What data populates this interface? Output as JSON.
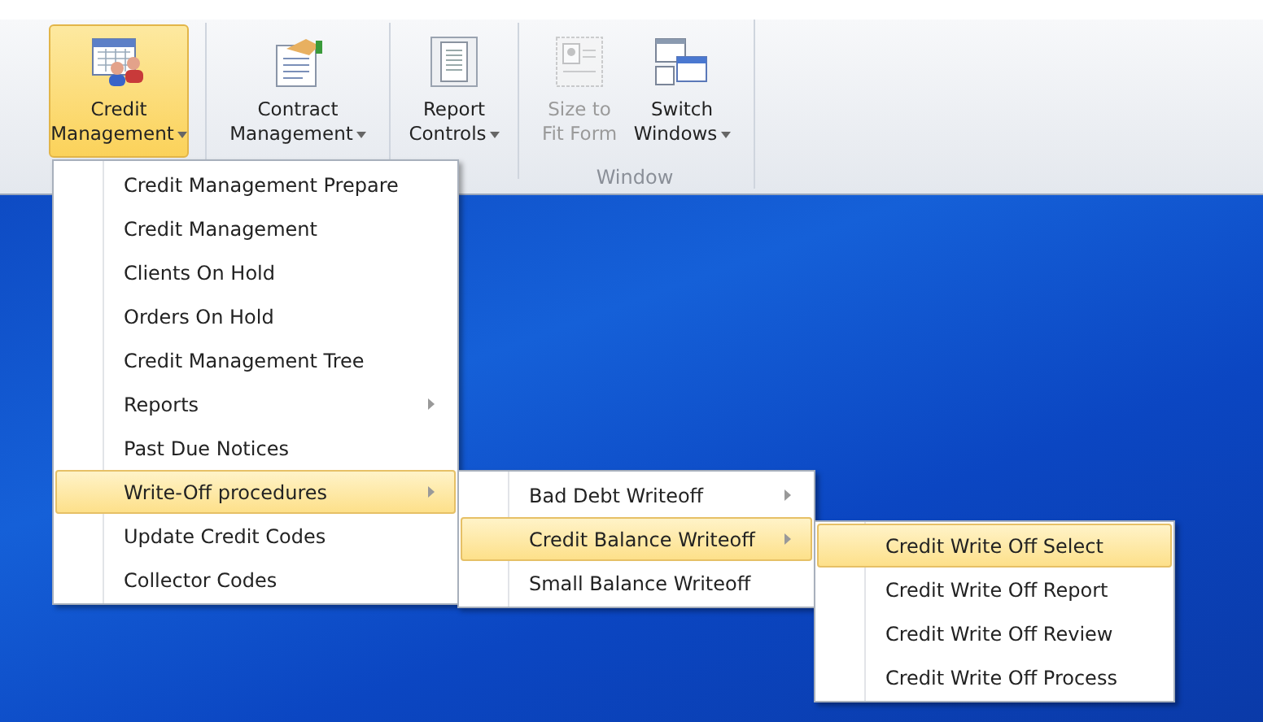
{
  "ribbon": {
    "buttons": [
      {
        "label": "Credit Management",
        "dropdown": true,
        "selected": true,
        "disabled": false
      },
      {
        "label": "Contract Management",
        "dropdown": true,
        "selected": false,
        "disabled": false
      },
      {
        "label": "Report Controls",
        "dropdown": true,
        "selected": false,
        "disabled": false
      },
      {
        "label": "Size to Fit Form",
        "dropdown": false,
        "selected": false,
        "disabled": true
      },
      {
        "label": "Switch Windows",
        "dropdown": true,
        "selected": false,
        "disabled": false
      }
    ],
    "group_label": "Window"
  },
  "menu": {
    "items": [
      {
        "label": "Credit Management Prepare",
        "submenu": false,
        "selected": false
      },
      {
        "label": "Credit Management",
        "submenu": false,
        "selected": false
      },
      {
        "label": "Clients On Hold",
        "submenu": false,
        "selected": false
      },
      {
        "label": "Orders On Hold",
        "submenu": false,
        "selected": false
      },
      {
        "label": "Credit Management Tree",
        "submenu": false,
        "selected": false
      },
      {
        "label": "Reports",
        "submenu": true,
        "selected": false
      },
      {
        "label": "Past Due Notices",
        "submenu": false,
        "selected": false
      },
      {
        "label": "Write-Off procedures",
        "submenu": true,
        "selected": true
      },
      {
        "label": "Update Credit Codes",
        "submenu": false,
        "selected": false
      },
      {
        "label": "Collector Codes",
        "submenu": false,
        "selected": false
      }
    ]
  },
  "submenu": {
    "items": [
      {
        "label": "Bad Debt Writeoff",
        "submenu": true,
        "selected": false
      },
      {
        "label": "Credit Balance Writeoff",
        "submenu": true,
        "selected": true
      },
      {
        "label": "Small Balance Writeoff",
        "submenu": false,
        "selected": false
      }
    ]
  },
  "submenu_2": {
    "items": [
      {
        "label": "Credit Write Off Select",
        "submenu": false,
        "selected": true
      },
      {
        "label": "Credit Write Off Report",
        "submenu": false,
        "selected": false
      },
      {
        "label": "Credit Write Off Review",
        "submenu": false,
        "selected": false
      },
      {
        "label": "Credit Write Off Process",
        "submenu": false,
        "selected": false
      }
    ]
  }
}
